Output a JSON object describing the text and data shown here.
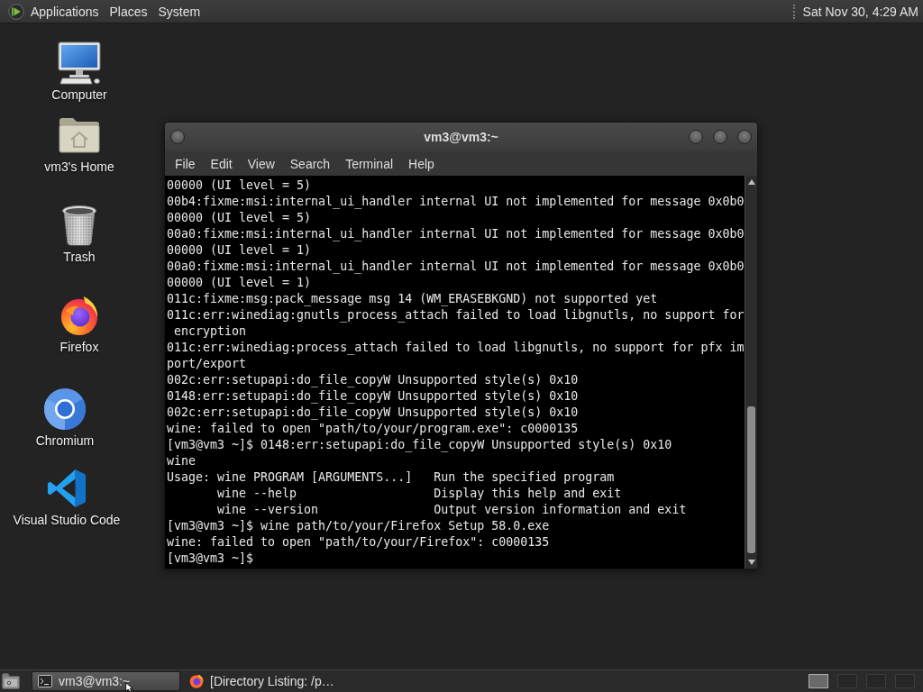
{
  "top_panel": {
    "menus": [
      "Applications",
      "Places",
      "System"
    ],
    "clock": "Sat Nov 30, 4:29 AM"
  },
  "desktop_icons": [
    {
      "label": "Computer",
      "kind": "computer"
    },
    {
      "label": "vm3's Home",
      "kind": "home"
    },
    {
      "label": "Trash",
      "kind": "trash"
    },
    {
      "label": "Firefox",
      "kind": "firefox"
    },
    {
      "label": "Chromium",
      "kind": "chromium"
    },
    {
      "label": "Visual Studio Code",
      "kind": "vscode"
    }
  ],
  "terminal": {
    "title": "vm3@vm3:~",
    "menu": [
      "File",
      "Edit",
      "View",
      "Search",
      "Terminal",
      "Help"
    ],
    "lines": [
      "00000 (UI level = 5)",
      "00b4:fixme:msi:internal_ui_handler internal UI not implemented for message 0x0b0",
      "00000 (UI level = 5)",
      "00a0:fixme:msi:internal_ui_handler internal UI not implemented for message 0x0b0",
      "00000 (UI level = 1)",
      "00a0:fixme:msi:internal_ui_handler internal UI not implemented for message 0x0b0",
      "00000 (UI level = 1)",
      "011c:fixme:msg:pack_message msg 14 (WM_ERASEBKGND) not supported yet",
      "011c:err:winediag:gnutls_process_attach failed to load libgnutls, no support for",
      " encryption",
      "011c:err:winediag:process_attach failed to load libgnutls, no support for pfx im",
      "port/export",
      "002c:err:setupapi:do_file_copyW Unsupported style(s) 0x10",
      "0148:err:setupapi:do_file_copyW Unsupported style(s) 0x10",
      "002c:err:setupapi:do_file_copyW Unsupported style(s) 0x10",
      "wine: failed to open \"path/to/your/program.exe\": c0000135",
      "[vm3@vm3 ~]$ 0148:err:setupapi:do_file_copyW Unsupported style(s) 0x10",
      "wine",
      "Usage: wine PROGRAM [ARGUMENTS...]   Run the specified program",
      "       wine --help                   Display this help and exit",
      "       wine --version                Output version information and exit",
      "[vm3@vm3 ~]$ wine path/to/your/Firefox Setup 58.0.exe",
      "wine: failed to open \"path/to/your/Firefox\": c0000135",
      "[vm3@vm3 ~]$"
    ]
  },
  "taskbar": {
    "tasks": [
      {
        "label": "vm3@vm3:~",
        "kind": "terminal",
        "selected": true
      },
      {
        "label": "[Directory Listing: /p…",
        "kind": "browser",
        "selected": false
      }
    ],
    "workspaces": [
      {
        "selected": true
      },
      {
        "selected": false
      },
      {
        "selected": false
      },
      {
        "selected": false
      }
    ]
  }
}
